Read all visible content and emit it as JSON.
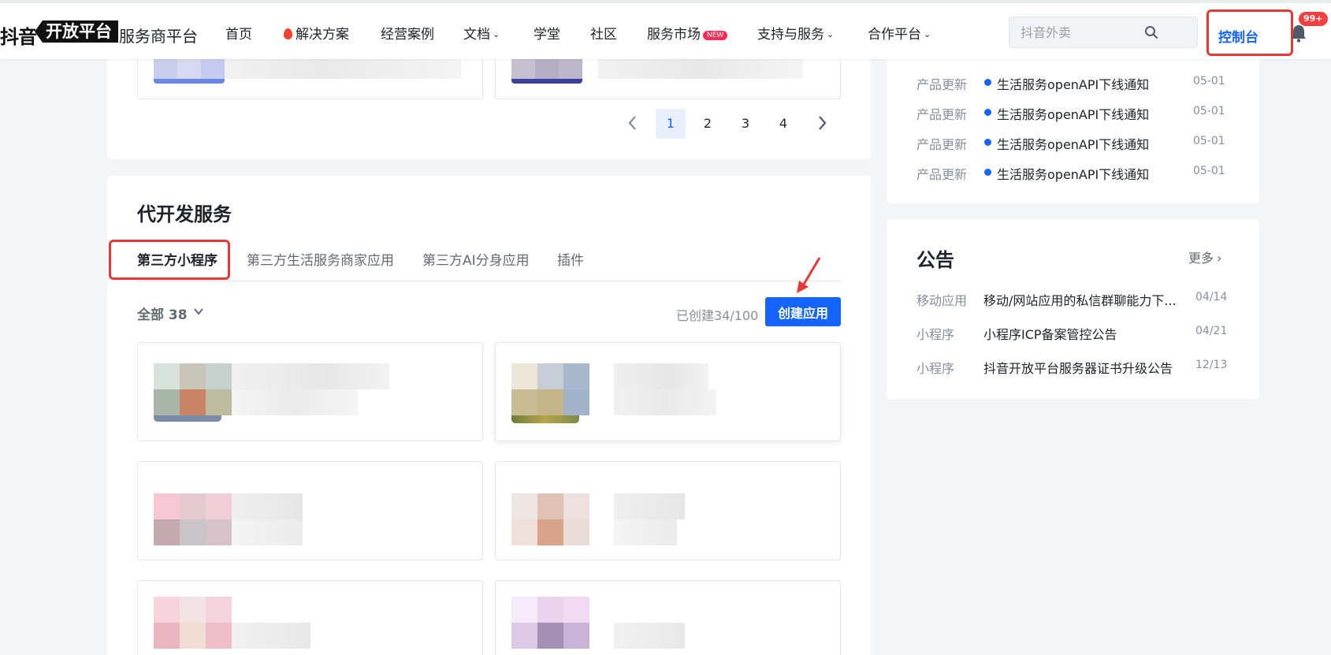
{
  "header": {
    "logo_prefix": "抖音",
    "logo_badge": "开放平台",
    "logo_sub": "服务商平台",
    "nav": [
      {
        "label": "首页"
      },
      {
        "label": "解决方案"
      },
      {
        "label": "经营案例"
      },
      {
        "label": "文档"
      },
      {
        "label": "学堂"
      },
      {
        "label": "社区"
      },
      {
        "label": "服务市场",
        "badge": "NEW"
      },
      {
        "label": "支持与服务"
      },
      {
        "label": "合作平台"
      }
    ],
    "search_placeholder": "抖音外卖",
    "console_label": "控制台",
    "notification_count": "99+"
  },
  "pagination": {
    "pages": [
      "1",
      "2",
      "3",
      "4"
    ],
    "current": "1"
  },
  "dev_services": {
    "title": "代开发服务",
    "tabs": [
      {
        "label": "第三方小程序",
        "active": true
      },
      {
        "label": "第三方生活服务商家应用"
      },
      {
        "label": "第三方AI分身应用"
      },
      {
        "label": "插件"
      }
    ],
    "filter_label": "全部 38",
    "created_count": "已创建34/100",
    "create_button": "创建应用"
  },
  "product_updates": [
    {
      "tag": "产品更新",
      "title": "生活服务openAPI下线通知",
      "date": "05-01"
    },
    {
      "tag": "产品更新",
      "title": "生活服务openAPI下线通知",
      "date": "05-01"
    },
    {
      "tag": "产品更新",
      "title": "生活服务openAPI下线通知",
      "date": "05-01"
    },
    {
      "tag": "产品更新",
      "title": "生活服务openAPI下线通知",
      "date": "05-01"
    }
  ],
  "announcements": {
    "title": "公告",
    "more": "更多",
    "items": [
      {
        "tag": "移动应用",
        "title": "移动/网站应用的私信群聊能力下...",
        "date": "04/14"
      },
      {
        "tag": "小程序",
        "title": "小程序ICP备案管控公告",
        "date": "04/21"
      },
      {
        "tag": "小程序",
        "title": "抖音开放平台服务器证书升级公告",
        "date": "12/13"
      }
    ]
  },
  "colors": {
    "accent": "#1664ff",
    "highlight": "#e53935",
    "badge": "#fe2c55"
  }
}
